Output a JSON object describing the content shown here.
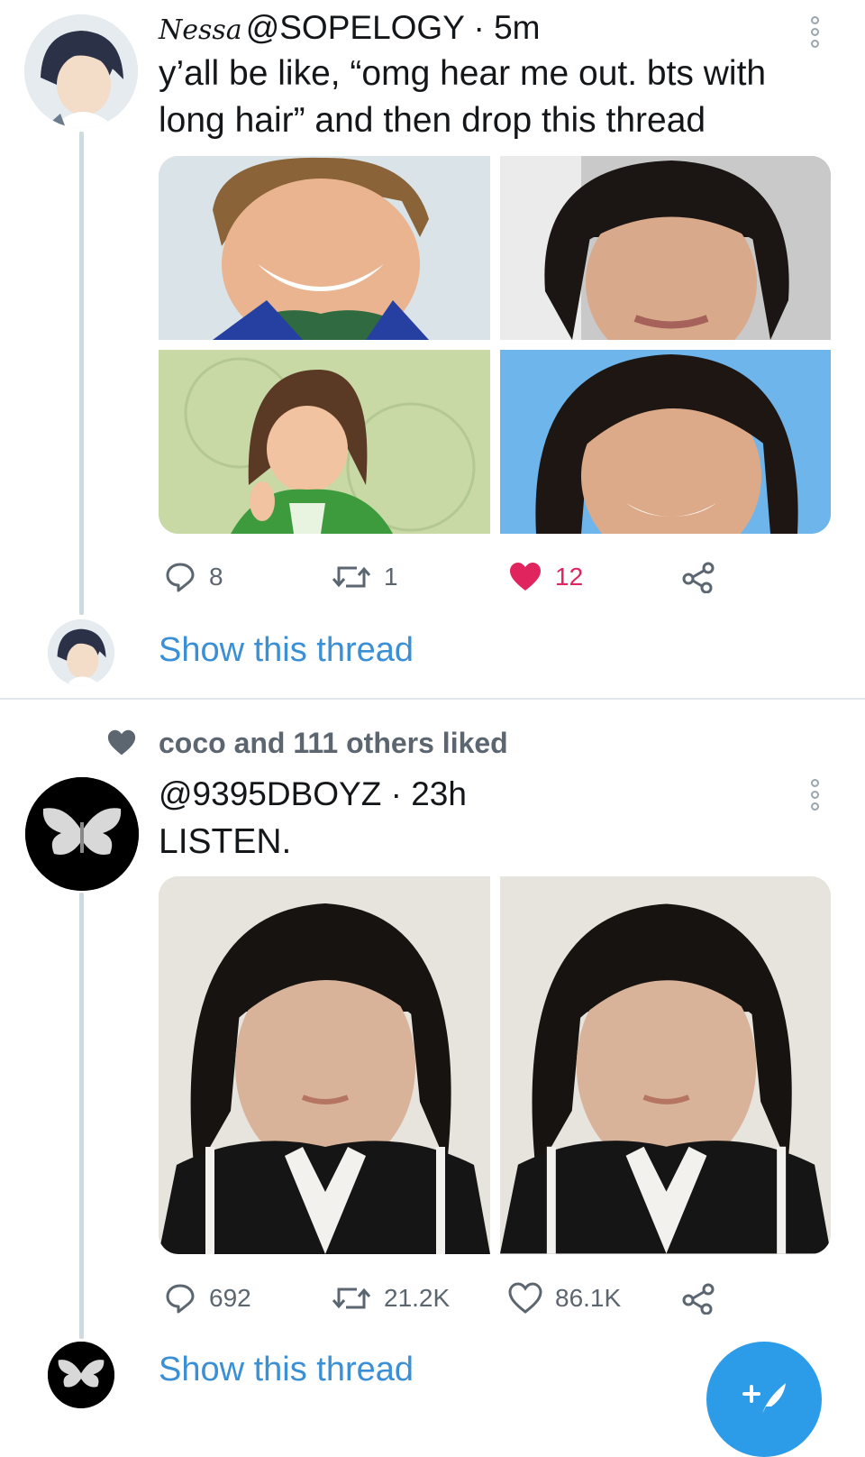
{
  "tweet1": {
    "display_name": "Nessa",
    "handle": "@SOPELOGY",
    "separator": "·",
    "time": "5m",
    "text_line1": "y’all be like, “omg hear me out. bts with",
    "text_line2": "long hair” and then drop this thread",
    "replies": "8",
    "retweets": "1",
    "likes": "12",
    "liked": true,
    "like_color": "#e0245e",
    "show_thread": "Show this thread"
  },
  "tweet2": {
    "social_context": "coco and 111 others liked",
    "handle": "@9395DBOYZ",
    "separator": "·",
    "time": "23h",
    "text": "LISTEN.",
    "replies": "692",
    "retweets": "21.2K",
    "likes": "86.1K",
    "liked": false,
    "show_thread": "Show this thread"
  },
  "colors": {
    "link": "#3b8fd4",
    "fab": "#2d9ce8",
    "muted": "#5b6670"
  },
  "icons": [
    "reply-icon",
    "retweet-icon",
    "heart-icon",
    "share-icon",
    "more-icon",
    "compose-icon"
  ]
}
